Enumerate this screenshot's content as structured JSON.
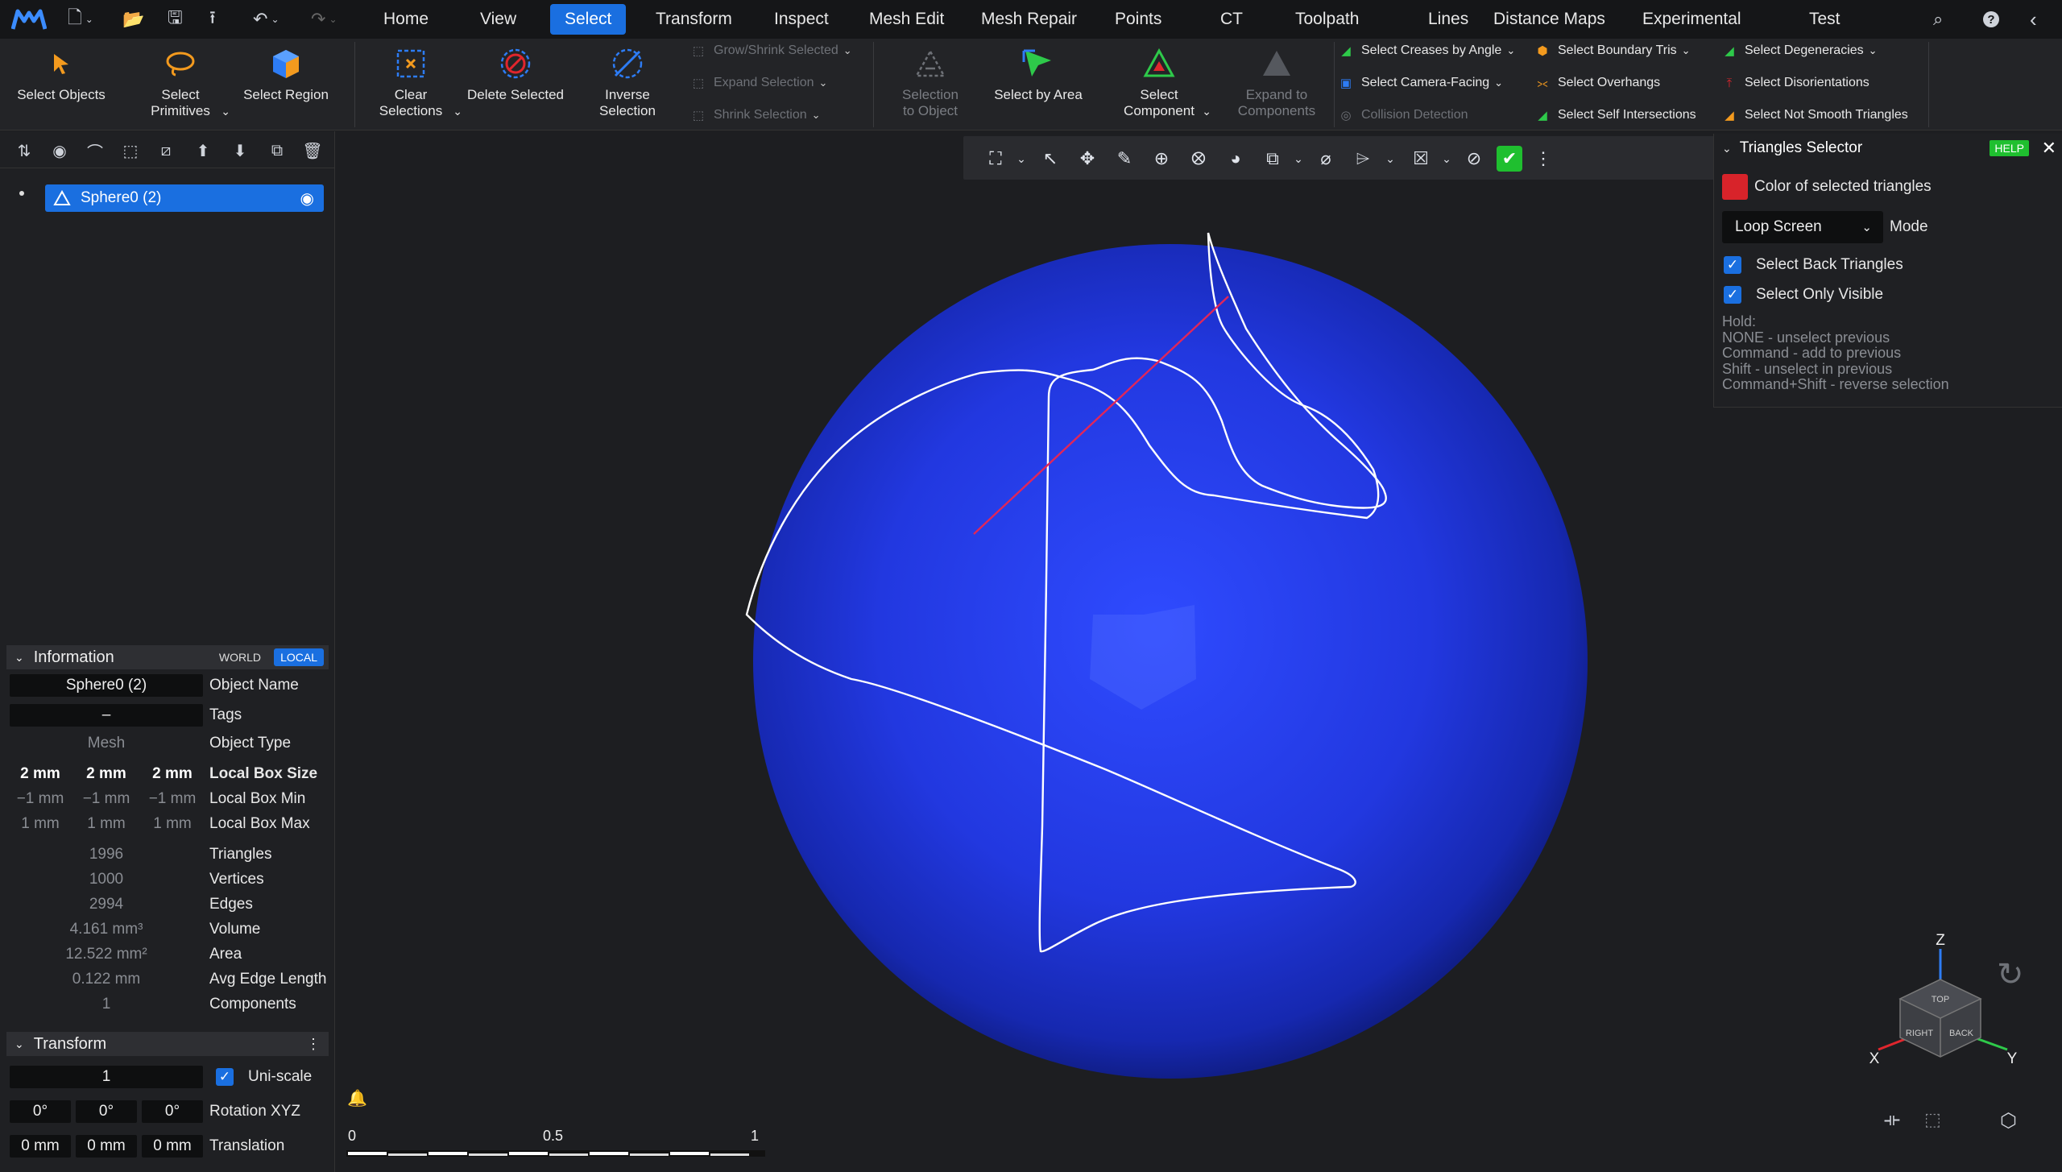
{
  "menubar": {
    "tabs": [
      {
        "label": "Home"
      },
      {
        "label": "View"
      },
      {
        "label": "Select"
      },
      {
        "label": "Transform"
      },
      {
        "label": "Inspect"
      },
      {
        "label": "Mesh Edit"
      },
      {
        "label": "Mesh Repair"
      },
      {
        "label": "Points"
      },
      {
        "label": "CT"
      },
      {
        "label": "Toolpath"
      },
      {
        "label": "Lines"
      },
      {
        "label": "Distance Maps"
      },
      {
        "label": "Experimental"
      },
      {
        "label": "Test"
      }
    ],
    "active_tab": "Select"
  },
  "ribbon": {
    "select_objects": "Select Objects",
    "select_primitives": "Select\nPrimitives",
    "select_region": "Select Region",
    "clear_selections": "Clear\nSelections",
    "delete_selected": "Delete Selected",
    "inverse_selection": "Inverse\nSelection",
    "grow_shrink": "Grow/Shrink Selected",
    "expand_selection": "Expand Selection",
    "shrink_selection": "Shrink Selection",
    "selection_to_object": "Selection\nto Object",
    "select_by_area": "Select by Area",
    "select_component": "Select\nComponent",
    "expand_to_components": "Expand to\nComponents",
    "select_creases": "Select Creases by Angle",
    "select_camera_facing": "Select Camera-Facing",
    "collision_detection": "Collision Detection",
    "select_boundary_tris": "Select Boundary Tris",
    "select_overhangs": "Select Overhangs",
    "select_self_intersections": "Select Self Intersections",
    "select_degeneracies": "Select Degeneracies",
    "select_disorientations": "Select Disorientations",
    "select_not_smooth": "Select Not Smooth Triangles"
  },
  "scene": {
    "item_label": "Sphere0 (2)"
  },
  "information": {
    "title": "Information",
    "world": "WORLD",
    "local": "LOCAL",
    "object_name_value": "Sphere0 (2)",
    "object_name_label": "Object Name",
    "tags_value": "–",
    "tags_label": "Tags",
    "object_type_value": "Mesh",
    "object_type_label": "Object Type",
    "box_size": [
      "2 mm",
      "2 mm",
      "2 mm"
    ],
    "box_size_label": "Local Box Size",
    "box_min": [
      "−1 mm",
      "−1 mm",
      "−1 mm"
    ],
    "box_min_label": "Local Box Min",
    "box_max": [
      "1 mm",
      "1 mm",
      "1 mm"
    ],
    "box_max_label": "Local Box Max",
    "triangles_value": "1996",
    "triangles_label": "Triangles",
    "vertices_value": "1000",
    "vertices_label": "Vertices",
    "edges_value": "2994",
    "edges_label": "Edges",
    "volume_value": "4.161 mm³",
    "volume_label": "Volume",
    "area_value": "12.522 mm²",
    "area_label": "Area",
    "avg_edge_value": "0.122 mm",
    "avg_edge_label": "Avg Edge Length",
    "components_value": "1",
    "components_label": "Components"
  },
  "transform": {
    "title": "Transform",
    "scale_value": "1",
    "uniscale_label": "Uni-scale",
    "rotation": [
      "0°",
      "0°",
      "0°"
    ],
    "rotation_label": "Rotation XYZ",
    "translation": [
      "0 mm",
      "0 mm",
      "0 mm"
    ],
    "translation_label": "Translation"
  },
  "triangles_selector": {
    "title": "Triangles Selector",
    "help": "HELP",
    "color_label": "Color of selected triangles",
    "selected_color": "#d8232a",
    "mode_value": "Loop Screen",
    "mode_label": "Mode",
    "back_triangles": "Select Back Triangles",
    "only_visible": "Select Only Visible",
    "hold_lines": [
      "Hold:",
      "NONE - unselect previous",
      "Command - add to previous",
      "Shift - unselect in previous",
      "Command+Shift - reverse selection"
    ]
  },
  "scale_bar": {
    "ticks": [
      "0",
      "0.5",
      "1"
    ]
  },
  "axes": {
    "z": "Z",
    "x": "X",
    "y": "Y"
  },
  "view_cube": {
    "top": "TOP",
    "right": "RIGHT",
    "back": "BACK"
  },
  "colors": {
    "accent": "#1a6fe0",
    "sphere": "#2238e0",
    "background": "#1d1e21"
  }
}
